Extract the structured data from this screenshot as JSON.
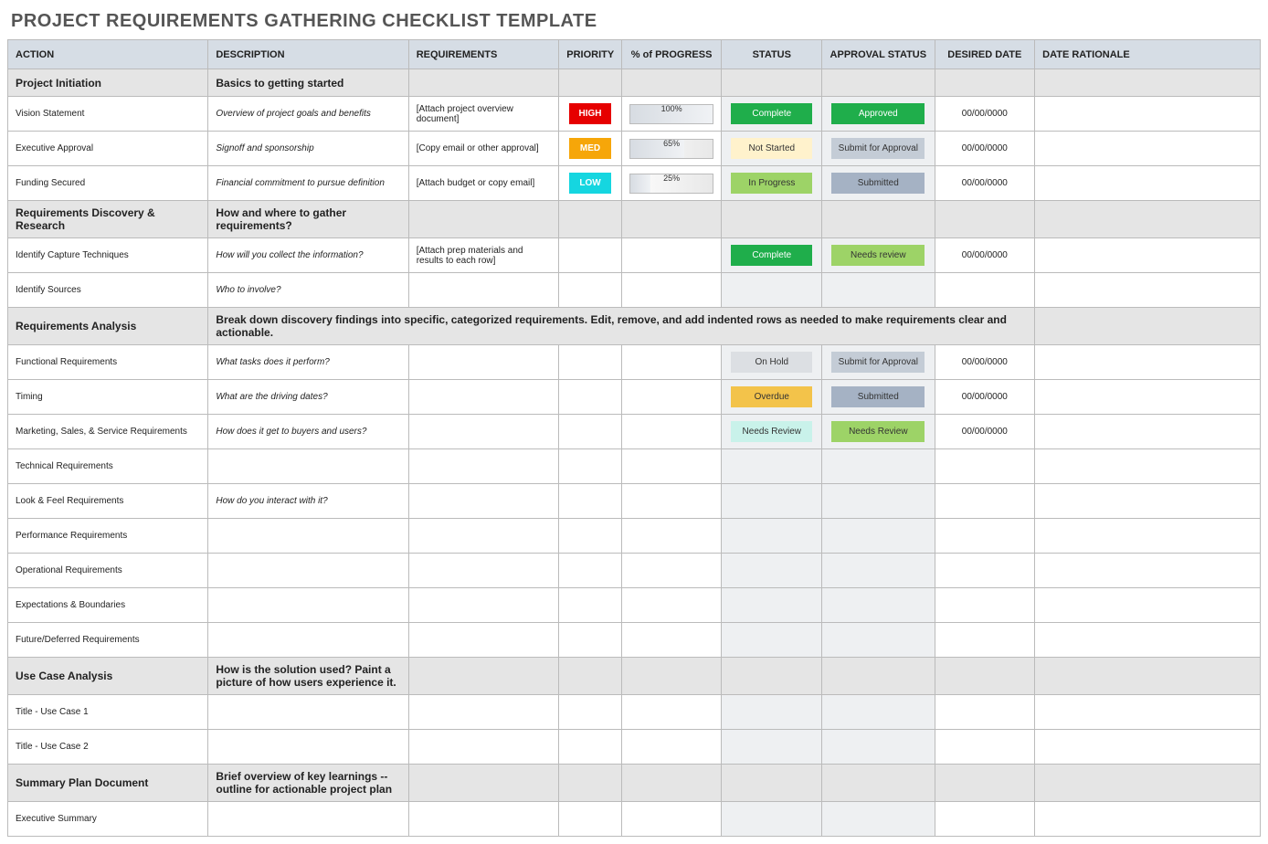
{
  "title": "PROJECT REQUIREMENTS GATHERING CHECKLIST TEMPLATE",
  "columns": [
    "ACTION",
    "DESCRIPTION",
    "REQUIREMENTS",
    "PRIORITY",
    "% of PROGRESS",
    "STATUS",
    "APPROVAL STATUS",
    "DESIRED DATE",
    "DATE RATIONALE"
  ],
  "colwidths": [
    "16%",
    "16%",
    "12%",
    "5%",
    "8%",
    "8%",
    "9%",
    "8%",
    "18%"
  ],
  "rows": [
    {
      "type": "section",
      "action": "Project Initiation",
      "description": "Basics to getting started"
    },
    {
      "type": "data",
      "action": "Vision Statement",
      "description": "Overview of project goals and benefits",
      "requirements": "[Attach project overview document]",
      "priority": "HIGH",
      "progress": 100,
      "status": "Complete",
      "approval": "Approved",
      "date": "00/00/0000"
    },
    {
      "type": "data",
      "action": "Executive Approval",
      "description": "Signoff and sponsorship",
      "requirements": "[Copy email or other approval]",
      "priority": "MED",
      "progress": 65,
      "status": "Not Started",
      "approval": "Submit for Approval",
      "date": "00/00/0000"
    },
    {
      "type": "data",
      "action": "Funding Secured",
      "description": "Financial commitment to pursue definition",
      "requirements": "[Attach budget or copy email]",
      "priority": "LOW",
      "progress": 25,
      "status": "In Progress",
      "approval": "Submitted",
      "date": "00/00/0000"
    },
    {
      "type": "section",
      "action": "Requirements Discovery & Research",
      "description": "How and where to gather requirements?"
    },
    {
      "type": "data",
      "action": "Identify Capture Techniques",
      "description": "How will you collect the information?",
      "requirements": "[Attach prep materials and results to each row]",
      "status": "Complete",
      "approval": "Needs review",
      "date": "00/00/0000"
    },
    {
      "type": "data",
      "action": "Identify Sources",
      "description": "Who to involve?"
    },
    {
      "type": "section",
      "action": "Requirements Analysis",
      "description": "Break down discovery findings into specific, categorized requirements. Edit, remove, and add indented rows as needed to make requirements clear and actionable.",
      "descSpan": 7
    },
    {
      "type": "data",
      "action": "Functional Requirements",
      "description": "What tasks does it perform?",
      "status": "On Hold",
      "approval": "Submit for Approval",
      "date": "00/00/0000"
    },
    {
      "type": "data",
      "action": "Timing",
      "description": "What are the driving dates?",
      "status": "Overdue",
      "approval": "Submitted",
      "date": "00/00/0000"
    },
    {
      "type": "data",
      "action": "Marketing, Sales, & Service Requirements",
      "description": "How does it get to buyers and users?",
      "status": "Needs Review",
      "approval": "Needs Review",
      "date": "00/00/0000"
    },
    {
      "type": "data",
      "action": "Technical Requirements"
    },
    {
      "type": "data",
      "action": "Look & Feel Requirements",
      "description": "How do you interact with it?"
    },
    {
      "type": "data",
      "action": "Performance Requirements"
    },
    {
      "type": "data",
      "action": "Operational Requirements"
    },
    {
      "type": "data",
      "action": "Expectations & Boundaries"
    },
    {
      "type": "data",
      "action": "Future/Deferred Requirements"
    },
    {
      "type": "section",
      "action": "Use Case Analysis",
      "description": "How is the solution used? Paint a picture of how users experience it."
    },
    {
      "type": "data",
      "action": "Title - Use Case 1"
    },
    {
      "type": "data",
      "action": "Title - Use Case 2"
    },
    {
      "type": "section",
      "action": "Summary Plan Document",
      "description": "Brief overview of key learnings -- outline for actionable project plan"
    },
    {
      "type": "data",
      "action": "Executive Summary"
    }
  ]
}
